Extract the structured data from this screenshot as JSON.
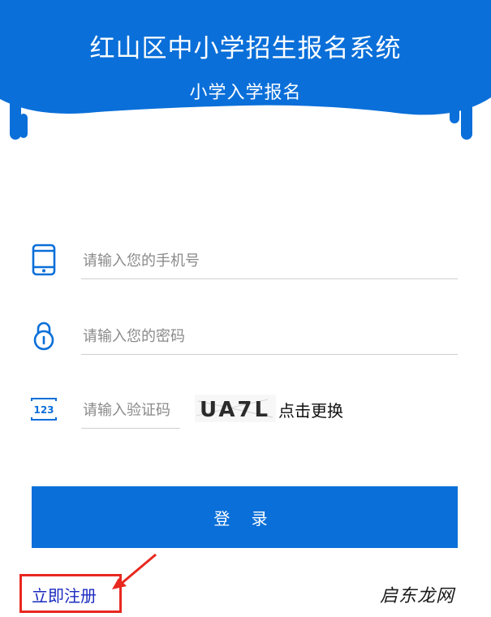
{
  "header": {
    "title": "红山区中小学招生报名系统",
    "subtitle": "小学入学报名",
    "color": "#0a6fd9"
  },
  "form": {
    "phone": {
      "placeholder": "请输入您的手机号",
      "value": "",
      "icon": "phone-icon"
    },
    "password": {
      "placeholder": "请输入您的密码",
      "value": "",
      "icon": "lock-icon"
    },
    "captcha": {
      "placeholder": "请输入验证码",
      "value": "",
      "icon": "number-123-icon",
      "image_text": "UA7L",
      "refresh_label": "点击更换"
    }
  },
  "login": {
    "label": "登 录",
    "color": "#0a6fd9"
  },
  "register": {
    "label": "立即注册",
    "highlight_color": "#e8281f"
  },
  "watermark": {
    "text": "启东龙网"
  }
}
